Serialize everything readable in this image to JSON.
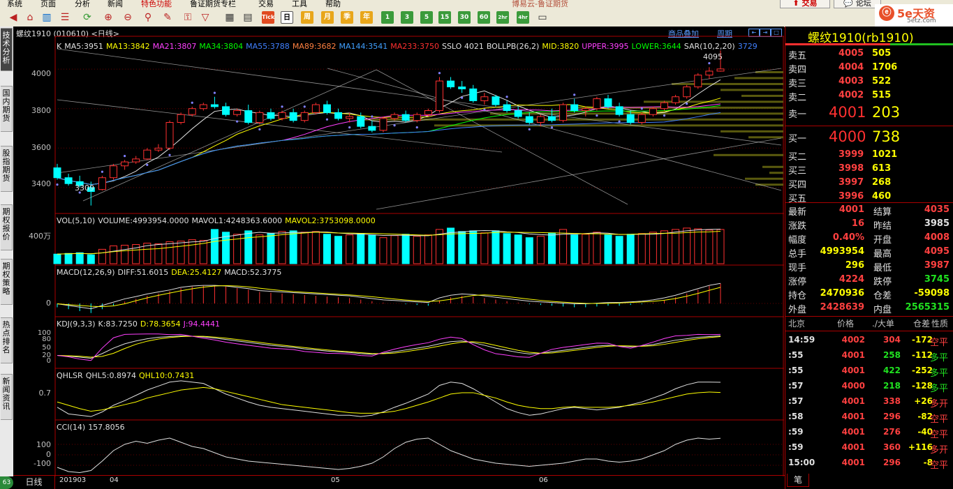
{
  "menu": {
    "items": [
      "系统",
      "页面",
      "分析",
      "新闻",
      "特色功能",
      "鲁证期货专栏",
      "交易",
      "工具",
      "帮助"
    ],
    "app_title": "博易云-鲁证期货",
    "trade_button": "交易",
    "forum_button": "论坛"
  },
  "toolbar": {
    "period_buttons": [
      "日",
      "周",
      "月",
      "季",
      "年"
    ],
    "minute_buttons": [
      "1",
      "3",
      "5",
      "15",
      "30",
      "60",
      "2hr",
      "4hr"
    ],
    "tick_label": "Tick"
  },
  "logo": {
    "text": "5e天资",
    "sub": "5etz.com"
  },
  "left_tabs": [
    "技术分析",
    "国内期货",
    "股指期货",
    "期权报价",
    "期权策略",
    "热点排名",
    "新闻资讯"
  ],
  "badge": "63",
  "chart": {
    "title": "螺纹1910 (010610) <日线>",
    "links": [
      "商品叠加",
      "周期"
    ],
    "colors": {
      "up": "#ff3030",
      "down": "#00ffff",
      "ma5": "#e0e0e0",
      "ma13": "#ffff00",
      "ma21": "#ff40ff",
      "ma34": "#00ff00",
      "ma55": "#4080ff",
      "ma89": "#ff8040",
      "ma144": "#40a0ff",
      "ma233": "#ff3030"
    },
    "main_legend": [
      {
        "text": "K",
        "color": "#e0e0e0"
      },
      {
        "text": "MA5:3951",
        "color": "#e0e0e0"
      },
      {
        "text": "MA13:3842",
        "color": "#ffff00"
      },
      {
        "text": "MA21:3807",
        "color": "#ff40ff"
      },
      {
        "text": "MA34:3804",
        "color": "#00ff00"
      },
      {
        "text": "MA55:3788",
        "color": "#4080ff"
      },
      {
        "text": "MA89:3682",
        "color": "#ff8040"
      },
      {
        "text": "MA144:3541",
        "color": "#40a0ff"
      },
      {
        "text": "MA233:3750",
        "color": "#ff3030"
      },
      {
        "text": "SSLO 4021",
        "color": "#e0e0e0"
      },
      {
        "text": "BOLLPB(26,2)",
        "color": "#e0e0e0"
      },
      {
        "text": "MID:3820",
        "color": "#ffff00"
      },
      {
        "text": "UPPER:3995",
        "color": "#ff40ff"
      },
      {
        "text": "LOWER:3644",
        "color": "#00ff00"
      },
      {
        "text": "SAR(10,2,20)",
        "color": "#e0e0e0"
      },
      {
        "text": "3729",
        "color": "#4080ff"
      }
    ],
    "price_axis": [
      "4000",
      "3800",
      "3600",
      "3400"
    ],
    "high_mark": "4095",
    "low_mark": "3309",
    "vol_legend": [
      {
        "text": "VOL(5,10)",
        "color": "#e0e0e0"
      },
      {
        "text": "VOLUME:4993954.0000",
        "color": "#e0e0e0"
      },
      {
        "text": "MAVOL1:4248363.6000",
        "color": "#e0e0e0"
      },
      {
        "text": "MAVOL2:3753098.0000",
        "color": "#ffff00"
      }
    ],
    "vol_axis": "400万",
    "macd_legend": [
      {
        "text": "MACD(12,26,9)",
        "color": "#e0e0e0"
      },
      {
        "text": "DIFF:51.6015",
        "color": "#e0e0e0"
      },
      {
        "text": "DEA:25.4127",
        "color": "#ffff00"
      },
      {
        "text": "MACD:52.3775",
        "color": "#e0e0e0"
      }
    ],
    "macd_axis": "0",
    "kdj_legend": [
      {
        "text": "KDJ(9,3,3)",
        "color": "#e0e0e0"
      },
      {
        "text": "K:83.7250",
        "color": "#e0e0e0"
      },
      {
        "text": "D:78.3654",
        "color": "#ffff00"
      },
      {
        "text": "J:94.4441",
        "color": "#ff40ff"
      }
    ],
    "kdj_axis": [
      "100",
      "80",
      "50",
      "20",
      "0"
    ],
    "qhl_legend": [
      {
        "text": "QHLSR",
        "color": "#e0e0e0"
      },
      {
        "text": "QHL5:0.8974",
        "color": "#e0e0e0"
      },
      {
        "text": "QHL10:0.7431",
        "color": "#ffff00"
      }
    ],
    "qhl_axis": "0.7",
    "cci_legend": [
      {
        "text": "CCI(14)",
        "color": "#e0e0e0"
      },
      {
        "text": "157.8056",
        "color": "#e0e0e0"
      }
    ],
    "cci_axis": [
      "100",
      "0",
      "-100"
    ],
    "period_label": "日线",
    "date_axis": [
      "201903",
      "04",
      "05",
      "06"
    ]
  },
  "quote": {
    "name": "螺纹1910(rb1910)",
    "asks": [
      {
        "label": "卖五",
        "price": "4005",
        "vol": "505"
      },
      {
        "label": "卖四",
        "price": "4004",
        "vol": "1706"
      },
      {
        "label": "卖三",
        "price": "4003",
        "vol": "522"
      },
      {
        "label": "卖二",
        "price": "4002",
        "vol": "515"
      },
      {
        "label": "卖一",
        "price": "4001",
        "vol": "203"
      }
    ],
    "bids": [
      {
        "label": "买一",
        "price": "4000",
        "vol": "738"
      },
      {
        "label": "买二",
        "price": "3999",
        "vol": "1021"
      },
      {
        "label": "买三",
        "price": "3998",
        "vol": "613"
      },
      {
        "label": "买四",
        "price": "3997",
        "vol": "268"
      },
      {
        "label": "买五",
        "price": "3996",
        "vol": "460"
      }
    ],
    "stats": [
      {
        "l1": "最新",
        "v1": "4001",
        "c1": "red",
        "l2": "结算",
        "v2": "4035",
        "c2": "red"
      },
      {
        "l1": "涨跌",
        "v1": "16",
        "c1": "red",
        "l2": "昨结",
        "v2": "3985",
        "c2": "white"
      },
      {
        "l1": "幅度",
        "v1": "0.40%",
        "c1": "red",
        "l2": "开盘",
        "v2": "4008",
        "c2": "red"
      },
      {
        "l1": "总手",
        "v1": "4993954",
        "c1": "yellow",
        "l2": "最高",
        "v2": "4095",
        "c2": "red"
      },
      {
        "l1": "现手",
        "v1": "296",
        "c1": "yellow",
        "l2": "最低",
        "v2": "3987",
        "c2": "red"
      },
      {
        "l1": "涨停",
        "v1": "4224",
        "c1": "red",
        "l2": "跌停",
        "v2": "3745",
        "c2": "green"
      },
      {
        "l1": "持仓",
        "v1": "2470936",
        "c1": "yellow",
        "l2": "仓差",
        "v2": "-59098",
        "c2": "yellow"
      },
      {
        "l1": "外盘",
        "v1": "2428639",
        "c1": "red",
        "l2": "内盘",
        "v2": "2565315",
        "c2": "green"
      }
    ],
    "ticks_header": [
      "北京",
      "价格",
      "./大单",
      "仓差",
      "性质"
    ],
    "ticks": [
      {
        "time": "14:59",
        "price": "4002",
        "pc": "red",
        "vol": "304",
        "vc": "red",
        "oi": "-172",
        "nature": "空平",
        "nc": "red"
      },
      {
        "time": ":55",
        "price": "4001",
        "pc": "red",
        "vol": "258",
        "vc": "green",
        "oi": "-112",
        "nature": "多平",
        "nc": "green"
      },
      {
        "time": ":55",
        "price": "4001",
        "pc": "red",
        "vol": "422",
        "vc": "green",
        "oi": "-252",
        "nature": "多平",
        "nc": "green"
      },
      {
        "time": ":57",
        "price": "4000",
        "pc": "red",
        "vol": "218",
        "vc": "green",
        "oi": "-128",
        "nature": "多平",
        "nc": "green"
      },
      {
        "time": ":57",
        "price": "4001",
        "pc": "red",
        "vol": "338",
        "vc": "red",
        "oi": "+26",
        "nature": "多开",
        "nc": "red"
      },
      {
        "time": ":58",
        "price": "4001",
        "pc": "red",
        "vol": "296",
        "vc": "red",
        "oi": "-82",
        "nature": "空平",
        "nc": "red"
      },
      {
        "time": ":59",
        "price": "4001",
        "pc": "red",
        "vol": "276",
        "vc": "red",
        "oi": "-40",
        "nature": "空平",
        "nc": "red"
      },
      {
        "time": ":59",
        "price": "4001",
        "pc": "red",
        "vol": "360",
        "vc": "red",
        "oi": "+116",
        "nature": "多开",
        "nc": "red"
      },
      {
        "time": "15:00",
        "price": "4001",
        "pc": "red",
        "vol": "296",
        "vc": "red",
        "oi": "-8",
        "nature": "空平",
        "nc": "red"
      }
    ],
    "bottom_tab": "笔"
  },
  "chart_data": {
    "type": "table",
    "candles": [
      {
        "o": 3500,
        "h": 3520,
        "l": 3440,
        "c": 3450
      },
      {
        "o": 3450,
        "h": 3470,
        "l": 3410,
        "c": 3420
      },
      {
        "o": 3430,
        "h": 3460,
        "l": 3400,
        "c": 3410
      },
      {
        "o": 3400,
        "h": 3430,
        "l": 3309,
        "c": 3380
      },
      {
        "o": 3390,
        "h": 3460,
        "l": 3385,
        "c": 3450
      },
      {
        "o": 3450,
        "h": 3520,
        "l": 3440,
        "c": 3510
      },
      {
        "o": 3510,
        "h": 3540,
        "l": 3490,
        "c": 3530
      },
      {
        "o": 3530,
        "h": 3560,
        "l": 3520,
        "c": 3545
      },
      {
        "o": 3545,
        "h": 3600,
        "l": 3540,
        "c": 3590
      },
      {
        "o": 3590,
        "h": 3620,
        "l": 3580,
        "c": 3600
      },
      {
        "o": 3600,
        "h": 3740,
        "l": 3590,
        "c": 3730
      },
      {
        "o": 3730,
        "h": 3780,
        "l": 3720,
        "c": 3770
      },
      {
        "o": 3770,
        "h": 3810,
        "l": 3760,
        "c": 3800
      },
      {
        "o": 3800,
        "h": 3830,
        "l": 3790,
        "c": 3820
      },
      {
        "o": 3820,
        "h": 3860,
        "l": 3800,
        "c": 3810
      },
      {
        "o": 3810,
        "h": 3830,
        "l": 3760,
        "c": 3770
      },
      {
        "o": 3770,
        "h": 3800,
        "l": 3760,
        "c": 3790
      },
      {
        "o": 3790,
        "h": 3820,
        "l": 3720,
        "c": 3730
      },
      {
        "o": 3730,
        "h": 3790,
        "l": 3720,
        "c": 3780
      },
      {
        "o": 3780,
        "h": 3800,
        "l": 3740,
        "c": 3750
      },
      {
        "o": 3750,
        "h": 3790,
        "l": 3740,
        "c": 3780
      },
      {
        "o": 3780,
        "h": 3800,
        "l": 3730,
        "c": 3740
      },
      {
        "o": 3740,
        "h": 3790,
        "l": 3730,
        "c": 3780
      },
      {
        "o": 3780,
        "h": 3830,
        "l": 3770,
        "c": 3820
      },
      {
        "o": 3820,
        "h": 3840,
        "l": 3770,
        "c": 3780
      },
      {
        "o": 3780,
        "h": 3800,
        "l": 3740,
        "c": 3750
      },
      {
        "o": 3750,
        "h": 3780,
        "l": 3730,
        "c": 3760
      },
      {
        "o": 3760,
        "h": 3780,
        "l": 3700,
        "c": 3710
      },
      {
        "o": 3710,
        "h": 3740,
        "l": 3680,
        "c": 3690
      },
      {
        "o": 3690,
        "h": 3760,
        "l": 3680,
        "c": 3750
      },
      {
        "o": 3750,
        "h": 3780,
        "l": 3740,
        "c": 3770
      },
      {
        "o": 3770,
        "h": 3790,
        "l": 3730,
        "c": 3740
      },
      {
        "o": 3740,
        "h": 3780,
        "l": 3730,
        "c": 3770
      },
      {
        "o": 3770,
        "h": 3800,
        "l": 3760,
        "c": 3790
      },
      {
        "o": 3790,
        "h": 3960,
        "l": 3780,
        "c": 3940
      },
      {
        "o": 3940,
        "h": 3960,
        "l": 3900,
        "c": 3910
      },
      {
        "o": 3910,
        "h": 3940,
        "l": 3880,
        "c": 3900
      },
      {
        "o": 3900,
        "h": 3920,
        "l": 3830,
        "c": 3840
      },
      {
        "o": 3840,
        "h": 3880,
        "l": 3820,
        "c": 3860
      },
      {
        "o": 3860,
        "h": 3870,
        "l": 3810,
        "c": 3820
      },
      {
        "o": 3820,
        "h": 3840,
        "l": 3780,
        "c": 3790
      },
      {
        "o": 3790,
        "h": 3810,
        "l": 3750,
        "c": 3760
      },
      {
        "o": 3760,
        "h": 3780,
        "l": 3720,
        "c": 3730
      },
      {
        "o": 3730,
        "h": 3770,
        "l": 3710,
        "c": 3760
      },
      {
        "o": 3760,
        "h": 3800,
        "l": 3730,
        "c": 3740
      },
      {
        "o": 3740,
        "h": 3830,
        "l": 3730,
        "c": 3820
      },
      {
        "o": 3820,
        "h": 3850,
        "l": 3780,
        "c": 3790
      },
      {
        "o": 3790,
        "h": 3810,
        "l": 3760,
        "c": 3800
      },
      {
        "o": 3800,
        "h": 3860,
        "l": 3790,
        "c": 3850
      },
      {
        "o": 3850,
        "h": 3870,
        "l": 3800,
        "c": 3810
      },
      {
        "o": 3810,
        "h": 3830,
        "l": 3760,
        "c": 3770
      },
      {
        "o": 3770,
        "h": 3790,
        "l": 3720,
        "c": 3730
      },
      {
        "o": 3730,
        "h": 3780,
        "l": 3720,
        "c": 3770
      },
      {
        "o": 3770,
        "h": 3810,
        "l": 3760,
        "c": 3800
      },
      {
        "o": 3800,
        "h": 3840,
        "l": 3790,
        "c": 3830
      },
      {
        "o": 3830,
        "h": 3870,
        "l": 3820,
        "c": 3860
      },
      {
        "o": 3860,
        "h": 3920,
        "l": 3850,
        "c": 3910
      },
      {
        "o": 3910,
        "h": 3980,
        "l": 3900,
        "c": 3970
      },
      {
        "o": 3970,
        "h": 4010,
        "l": 3950,
        "c": 3990
      },
      {
        "o": 3990,
        "h": 4095,
        "l": 3987,
        "c": 4001
      }
    ],
    "volumes": [
      140,
      150,
      160,
      130,
      210,
      260,
      270,
      280,
      300,
      290,
      320,
      330,
      350,
      340,
      500,
      460,
      430,
      480,
      420,
      440,
      470,
      480,
      460,
      470,
      430,
      400,
      420,
      440,
      420,
      380,
      410,
      430,
      400,
      420,
      500,
      520,
      470,
      480,
      450,
      480,
      440,
      420,
      380,
      400,
      450,
      500,
      420,
      430,
      460,
      420,
      400,
      430,
      440,
      460,
      480,
      500,
      520,
      510,
      490,
      499
    ],
    "macd": [
      -10,
      -15,
      -20,
      -25,
      -15,
      -5,
      5,
      12,
      20,
      26,
      32,
      40,
      44,
      46,
      46,
      44,
      40,
      36,
      30,
      28,
      26,
      24,
      22,
      20,
      18,
      16,
      14,
      10,
      6,
      2,
      0,
      -2,
      -4,
      -6,
      8,
      16,
      20,
      18,
      14,
      10,
      6,
      2,
      -2,
      -4,
      -6,
      -8,
      -10,
      -10,
      -8,
      -6,
      -6,
      -4,
      -2,
      2,
      8,
      16,
      26,
      36,
      46,
      52
    ],
    "kdj_k": [
      30,
      28,
      25,
      22,
      35,
      50,
      62,
      70,
      76,
      80,
      82,
      84,
      83,
      81,
      78,
      74,
      70,
      66,
      62,
      58,
      55,
      52,
      48,
      45,
      42,
      40,
      38,
      35,
      33,
      36,
      40,
      45,
      50,
      55,
      62,
      68,
      70,
      65,
      58,
      50,
      44,
      38,
      34,
      36,
      40,
      44,
      48,
      52,
      56,
      58,
      56,
      54,
      56,
      60,
      66,
      72,
      76,
      80,
      82,
      84
    ],
    "qhl5": [
      0.52,
      0.42,
      0.4,
      0.38,
      0.45,
      0.55,
      0.62,
      0.7,
      0.78,
      0.84,
      0.9,
      0.92,
      0.9,
      0.88,
      0.8,
      0.72,
      0.66,
      0.6,
      0.55,
      0.52,
      0.5,
      0.48,
      0.46,
      0.44,
      0.42,
      0.4,
      0.4,
      0.38,
      0.4,
      0.45,
      0.52,
      0.58,
      0.65,
      0.72,
      0.85,
      0.9,
      0.88,
      0.8,
      0.7,
      0.6,
      0.5,
      0.44,
      0.4,
      0.42,
      0.46,
      0.5,
      0.52,
      0.5,
      0.48,
      0.5,
      0.52,
      0.56,
      0.6,
      0.66,
      0.72,
      0.8,
      0.86,
      0.9,
      0.9,
      0.897
    ],
    "qhl10": [
      0.6,
      0.55,
      0.5,
      0.46,
      0.48,
      0.52,
      0.56,
      0.6,
      0.66,
      0.7,
      0.74,
      0.78,
      0.8,
      0.82,
      0.8,
      0.76,
      0.72,
      0.68,
      0.64,
      0.6,
      0.56,
      0.54,
      0.52,
      0.5,
      0.48,
      0.46,
      0.44,
      0.43,
      0.43,
      0.44,
      0.46,
      0.5,
      0.55,
      0.6,
      0.66,
      0.72,
      0.74,
      0.74,
      0.7,
      0.66,
      0.6,
      0.55,
      0.52,
      0.5,
      0.5,
      0.52,
      0.53,
      0.52,
      0.52,
      0.52,
      0.53,
      0.55,
      0.57,
      0.6,
      0.64,
      0.68,
      0.72,
      0.74,
      0.75,
      0.743
    ],
    "cci": [
      -120,
      -160,
      -170,
      -150,
      -60,
      40,
      100,
      130,
      110,
      140,
      160,
      120,
      80,
      60,
      20,
      -20,
      -40,
      -60,
      -70,
      -80,
      -90,
      -100,
      -110,
      -120,
      -130,
      -140,
      -130,
      -110,
      -80,
      -20,
      60,
      120,
      150,
      160,
      100,
      40,
      0,
      -40,
      -60,
      -80,
      -90,
      -100,
      -110,
      -100,
      -90,
      -80,
      -60,
      -40,
      -40,
      -60,
      -70,
      -60,
      -40,
      0,
      40,
      100,
      140,
      160,
      150,
      158
    ]
  }
}
